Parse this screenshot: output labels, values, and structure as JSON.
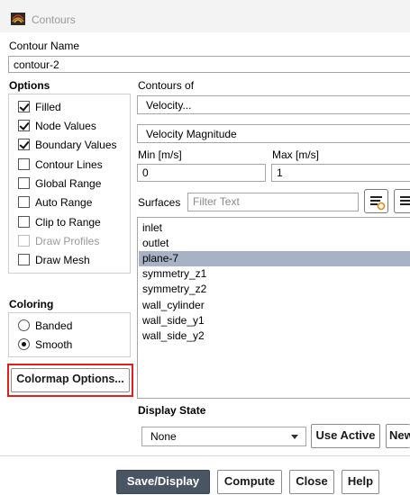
{
  "window": {
    "title": "Contours",
    "icon": "contours-app-icon"
  },
  "contour_name": {
    "label": "Contour Name",
    "value": "contour-2"
  },
  "options": {
    "label": "Options",
    "items": [
      {
        "label": "Filled",
        "checked": true,
        "disabled": false
      },
      {
        "label": "Node Values",
        "checked": true,
        "disabled": false
      },
      {
        "label": "Boundary Values",
        "checked": true,
        "disabled": false
      },
      {
        "label": "Contour Lines",
        "checked": false,
        "disabled": false
      },
      {
        "label": "Global Range",
        "checked": false,
        "disabled": false
      },
      {
        "label": "Auto Range",
        "checked": false,
        "disabled": false
      },
      {
        "label": "Clip to Range",
        "checked": false,
        "disabled": false
      },
      {
        "label": "Draw Profiles",
        "checked": false,
        "disabled": true
      },
      {
        "label": "Draw Mesh",
        "checked": false,
        "disabled": false
      }
    ]
  },
  "coloring": {
    "label": "Coloring",
    "options": [
      {
        "label": "Banded",
        "selected": false
      },
      {
        "label": "Smooth",
        "selected": true
      }
    ]
  },
  "colormap_button": {
    "label": "Colormap Options..."
  },
  "contours_of": {
    "label": "Contours of",
    "category": "Velocity...",
    "quantity": "Velocity Magnitude"
  },
  "range": {
    "min_label": "Min [m/s]",
    "min_value": "0",
    "max_label": "Max [m/s]",
    "max_value": "1"
  },
  "surfaces": {
    "label": "Surfaces",
    "filter_placeholder": "Filter Text",
    "items": [
      "inlet",
      "outlet",
      "plane-7",
      "symmetry_z1",
      "symmetry_z2",
      "wall_cylinder",
      "wall_side_y1",
      "wall_side_y2"
    ],
    "selected": "plane-7"
  },
  "display_state": {
    "label": "Display State",
    "value": "None",
    "use_active_label": "Use Active",
    "new_label": "New..."
  },
  "footer": {
    "save_display": "Save/Display",
    "compute": "Compute",
    "close": "Close",
    "help": "Help"
  },
  "colors": {
    "selection": "#a7b3c5",
    "primary_button": "#4a5563",
    "highlight": "#e02020"
  }
}
